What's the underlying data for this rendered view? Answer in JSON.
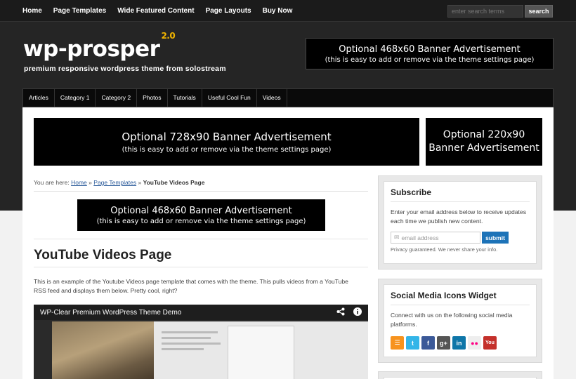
{
  "top_nav": {
    "items": [
      "Home",
      "Page Templates",
      "Wide Featured Content",
      "Page Layouts",
      "Buy Now"
    ],
    "search_placeholder": "enter search terms",
    "search_button": "search"
  },
  "header": {
    "logo": "wp-prosper",
    "version": "2.0",
    "tagline": "premium responsive wordpress theme from solostream",
    "banner_line1": "Optional 468x60 Banner Advertisement",
    "banner_line2": "(this is easy to add or remove via the theme settings page)"
  },
  "category_nav": {
    "items": [
      "Articles",
      "Category 1",
      "Category 2",
      "Photos",
      "Tutorials",
      "Useful Cool Fun",
      "Videos"
    ]
  },
  "banners": {
    "b728_line1": "Optional 728x90 Banner Advertisement",
    "b728_line2": "(this is easy to add or remove via the theme settings page)",
    "b220_line1": "Optional 220x90",
    "b220_line2": "Banner Advertisement",
    "b468_line1": "Optional 468x60 Banner Advertisement",
    "b468_line2": "(this is easy to add or remove via the theme settings page)"
  },
  "breadcrumb": {
    "prefix": "You are here:",
    "home": "Home",
    "sep": "»",
    "parent": "Page Templates",
    "current": "YouTube Videos Page"
  },
  "page": {
    "title": "YouTube Videos Page",
    "intro": "This is an example of the Youtube Videos page template that comes with the theme. This pulls videos from a YouTube RSS feed and displays them below. Pretty cool, right?"
  },
  "video": {
    "title": "WP-Clear Premium WordPress Theme Demo",
    "share_icon": "share-icon",
    "info_icon": "info-icon"
  },
  "subscribe_widget": {
    "title": "Subscribe",
    "text": "Enter your email address below to receive updates each time we publish new content.",
    "email_placeholder": "email address",
    "button": "submit",
    "privacy": "Privacy guaranteed. We never share your info."
  },
  "social_widget": {
    "title": "Social Media Icons Widget",
    "text": "Connect with us on the following social media platforms.",
    "icons": [
      {
        "name": "rss-icon",
        "glyph": "☰",
        "color": "#f7931e"
      },
      {
        "name": "twitter-icon",
        "glyph": "t",
        "color": "#33b5e8"
      },
      {
        "name": "facebook-icon",
        "glyph": "f",
        "color": "#3b5998"
      },
      {
        "name": "google-plus-icon",
        "glyph": "g+",
        "color": "#555555"
      },
      {
        "name": "linkedin-icon",
        "glyph": "in",
        "color": "#0e76a8"
      },
      {
        "name": "flickr-icon",
        "glyph": "●●",
        "color": "#eeeeee"
      },
      {
        "name": "youtube-icon",
        "glyph": "You",
        "color": "#c4302b"
      }
    ]
  },
  "colors": {
    "dark_background": "#252525",
    "accent_yellow": "#f0b400",
    "link_blue": "#2a5a9a",
    "button_blue": "#1d73b8"
  }
}
